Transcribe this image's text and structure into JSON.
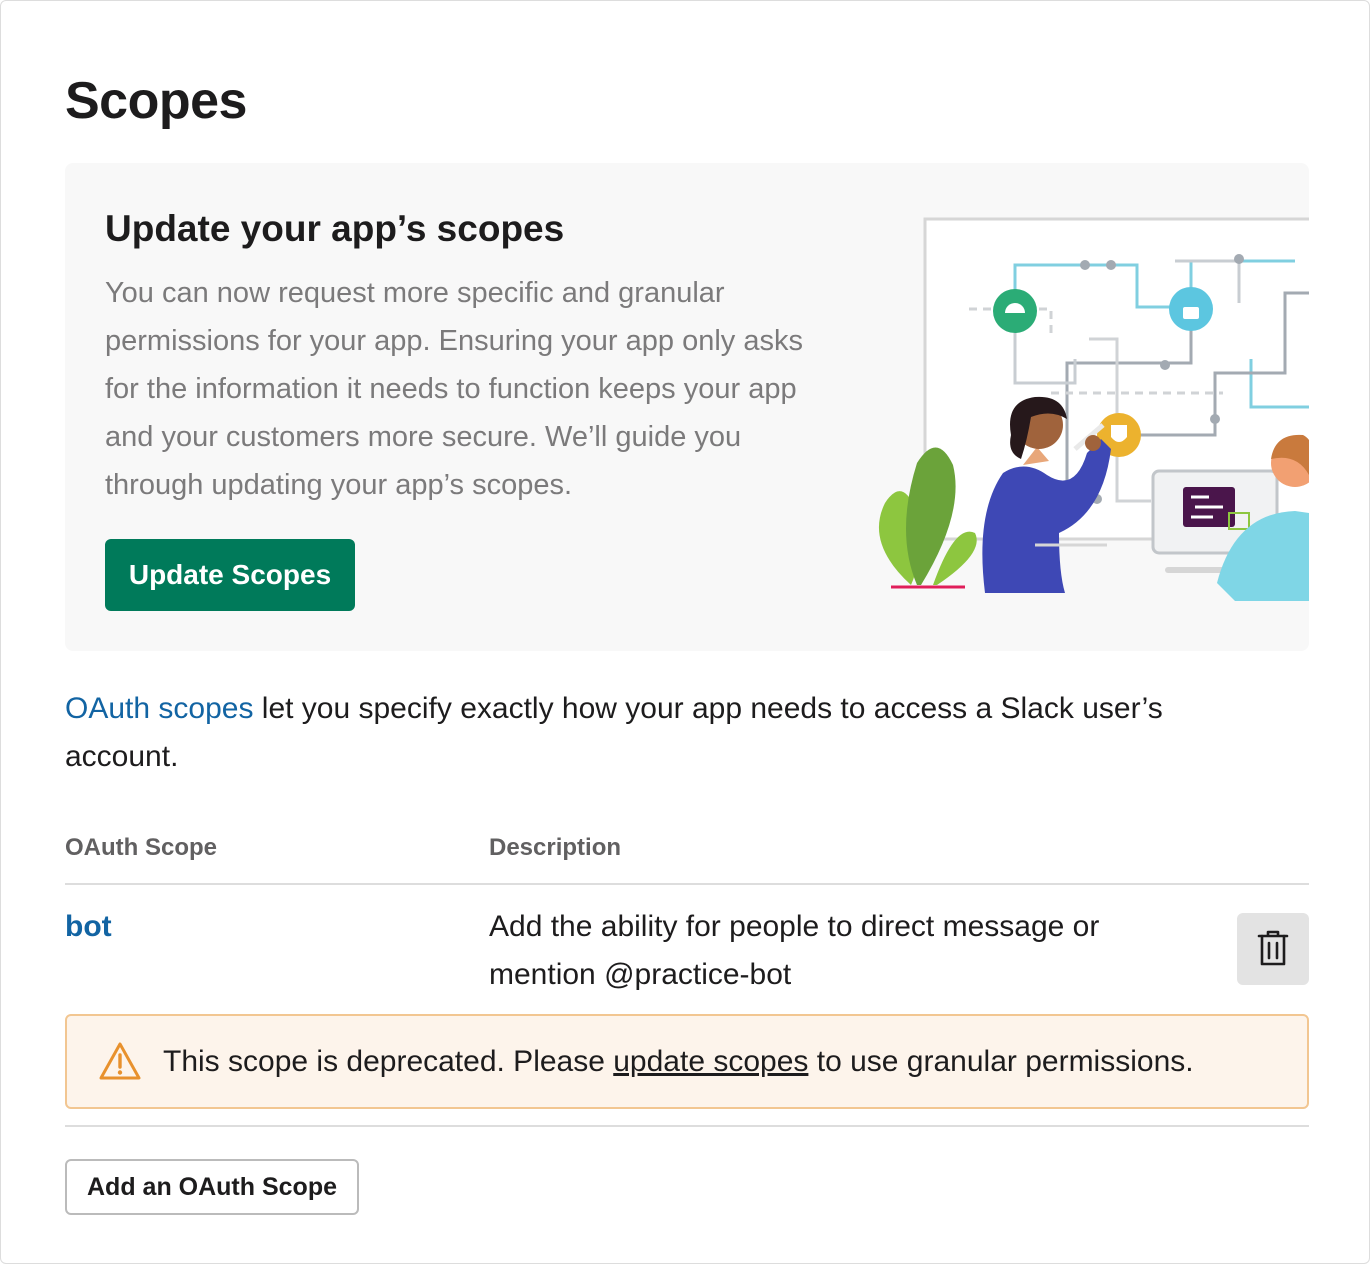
{
  "page": {
    "title": "Scopes"
  },
  "banner": {
    "title": "Update your app’s scopes",
    "body": "You can now request more specific and granular permissions for your app. Ensuring your app only asks for the information it needs to function keeps your app and your customers more secure. We’ll guide you through updating your app’s scopes.",
    "button_label": "Update Scopes",
    "illustration_icon": "people-connecting-permissions-illustration"
  },
  "intro": {
    "link_text": "OAuth scopes",
    "text": " let you specify exactly how your app needs to access a Slack user’s account."
  },
  "table": {
    "headers": [
      "OAuth Scope",
      "Description"
    ],
    "rows": [
      {
        "scope": "bot",
        "description": "Add the ability for people to direct message or mention @practice-bot",
        "action_icon": "trash-icon"
      }
    ]
  },
  "warning": {
    "icon": "warning-triangle-icon",
    "text_before": "This scope is deprecated. Please ",
    "link_text": "update scopes",
    "text_after": " to use granular permissions."
  },
  "add_button_label": "Add an OAuth Scope",
  "colors": {
    "primary_button": "#007a5a",
    "link": "#1264a3",
    "warning_background": "#fdf4eb",
    "warning_border": "#f2c691",
    "warning_icon": "#e8912d",
    "banner_background": "#f8f8f8"
  }
}
